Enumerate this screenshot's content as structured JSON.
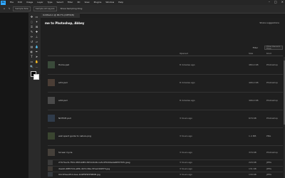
{
  "menubar": {
    "logo": "Ps",
    "items": [
      "File",
      "Edit",
      "Image",
      "Layer",
      "Type",
      "Select",
      "Filter",
      "3D",
      "View",
      "Plugins",
      "Window",
      "Help"
    ]
  },
  "options": {
    "items": [
      "Sample Size",
      "Sample All Layers",
      "Show Sampling Ring"
    ]
  },
  "doc_tab": {
    "label": "Untitled-1 @ 66.7% (CMYK/8)"
  },
  "main": {
    "title": "me to Photoshop, Abbey",
    "share": "Share suggestions",
    "filter_label": "Filter",
    "filter_placeholder": "Filter Recent Files",
    "columns": {
      "opened": "Opened",
      "size": "Size",
      "kind": "Kind"
    }
  },
  "files": [
    {
      "name": "Home.psd",
      "opened": "8 minutes ago",
      "size": "480.4 KB",
      "kind": "Photoshop"
    },
    {
      "name": "art1.psd",
      "opened": "8 minutes ago",
      "size": "406.2 KB",
      "kind": "Photoshop"
    },
    {
      "name": "art2.psd",
      "opened": "8 minutes ago",
      "size": "406.4 KB",
      "kind": "Photoshop"
    },
    {
      "name": "NOTICE.psd",
      "opened": "3 hours ago",
      "size": "679 KB",
      "kind": "Photoshop"
    },
    {
      "name": "well spent guide to nature.png",
      "opened": "3 hours ago",
      "size": "1.4 MB",
      "kind": "PNG"
    },
    {
      "name": "Screen Cycle",
      "opened": "3 hours ago",
      "size": "379 KB",
      "kind": "Photoshop"
    },
    {
      "name": "27b71ac6-7f04-4f0f-9d85-f4f212b46-1a5c2f5d09e4a6f057f25.jpeg",
      "opened": "3 hours ago",
      "size": "229 KB",
      "kind": "JPEG"
    },
    {
      "name": "dae4d-48f07d4-a6fb-4b72-82e-5f1a2d09f73.jpg",
      "opened": "3 hours ago",
      "size": "131 KB",
      "kind": "JPEG"
    },
    {
      "name": "94c1f4ae4f14-bee-1b9ff9f9fdf9B0B.jpg",
      "opened": "3 hours ago",
      "size": "139 KB",
      "kind": "JPEG"
    }
  ],
  "colors": {
    "accent": "#31a8ff",
    "bg": "#1e1e1e"
  }
}
